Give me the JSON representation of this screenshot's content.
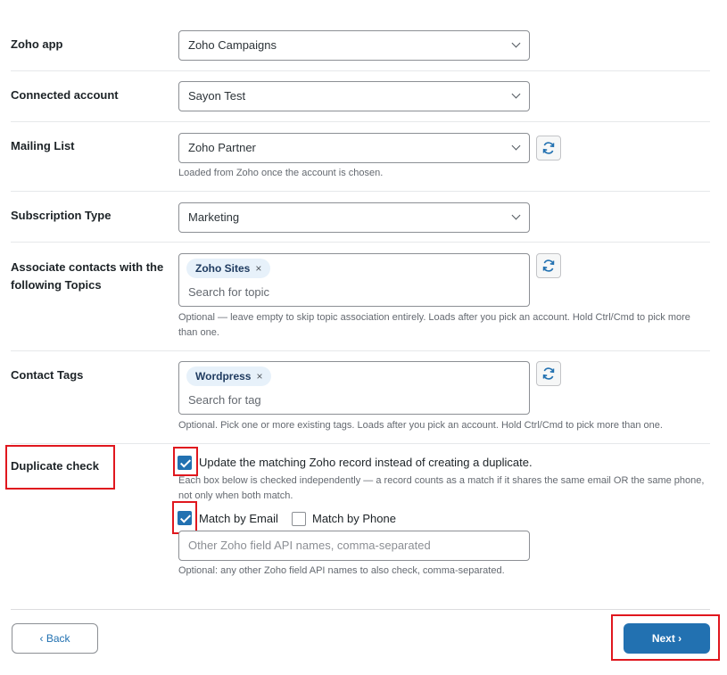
{
  "fields": {
    "zoho_app": {
      "label": "Zoho app",
      "value": "Zoho Campaigns"
    },
    "connected_account": {
      "label": "Connected account",
      "value": "Sayon Test"
    },
    "mailing_list": {
      "label": "Mailing List",
      "value": "Zoho Partner",
      "help": "Loaded from Zoho once the account is chosen."
    },
    "subscription_type": {
      "label": "Subscription Type",
      "value": "Marketing"
    },
    "topics": {
      "label_line1": "Associate contacts with the",
      "label_line2": "following Topics",
      "chip": "Zoho Sites",
      "placeholder": "Search for topic",
      "help_line1": "Optional — leave empty to skip topic association entirely. Loads after you pick an account. Hold Ctrl/Cmd to pick more",
      "help_line2": "than one."
    },
    "contact_tags": {
      "label": "Contact Tags",
      "chip": "Wordpress",
      "placeholder": "Search for tag",
      "help": "Optional. Pick one or more existing tags. Loads after you pick an account. Hold Ctrl/Cmd to pick more than one."
    },
    "duplicate_check": {
      "label": "Duplicate check",
      "update_label": "Update the matching Zoho record instead of creating a duplicate.",
      "update_checked": true,
      "info_line1": "Each box below is checked independently — a record counts as a match if it shares the same email OR the same phone,",
      "info_line2": "not only when both match.",
      "match_email_label": "Match by Email",
      "match_email_checked": true,
      "match_phone_label": "Match by Phone",
      "match_phone_checked": false,
      "other_fields_placeholder": "Other Zoho field API names, comma-separated",
      "other_fields_help": "Optional: any other Zoho field API names to also check, comma-separated."
    }
  },
  "buttons": {
    "back": "‹ Back",
    "next": "Next ›"
  },
  "icons": {
    "chevron": "chevron-down-icon",
    "refresh": "refresh-icon",
    "close": "close-icon",
    "check": "check-icon"
  },
  "colors": {
    "accent": "#2271b1",
    "highlight": "#e0171e",
    "chip_bg": "#e7f1fa"
  }
}
